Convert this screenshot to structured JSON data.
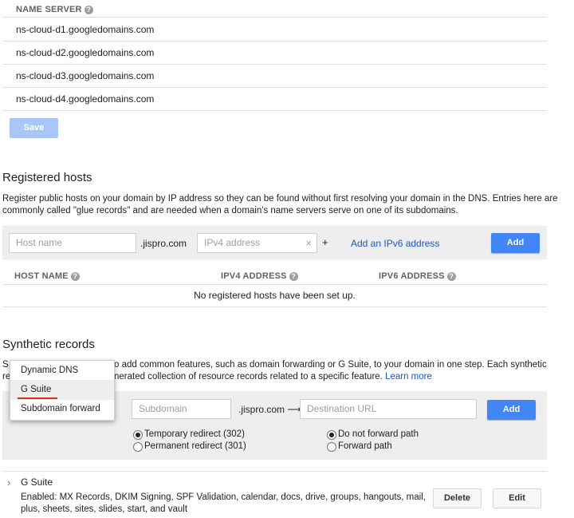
{
  "nameservers": {
    "header": "NAME SERVER",
    "items": [
      "ns-cloud-d1.googledomains.com",
      "ns-cloud-d2.googledomains.com",
      "ns-cloud-d3.googledomains.com",
      "ns-cloud-d4.googledomains.com"
    ],
    "save_label": "Save"
  },
  "registered_hosts": {
    "title": "Registered hosts",
    "description_line1": "Register public hosts on your domain by IP address so they can be found without first resolving your domain in the DNS. Entries here are",
    "description_line2": "commonly called \"glue records\" and are needed when a domain's name servers serve on one of its subdomains.",
    "host_placeholder": "Host name",
    "domain_suffix": ".jispro.com",
    "ipv4_placeholder": "IPv4 address",
    "clear_glyph": "×",
    "plus_glyph": "+",
    "add_ipv6_link": "Add an IPv6 address",
    "add_label": "Add",
    "columns": [
      "HOST NAME",
      "IPV4 ADDRESS",
      "IPV6 ADDRESS"
    ],
    "empty_message": "No registered hosts have been set up."
  },
  "synthetic_records": {
    "title": "Synthetic records",
    "description_line1_lead": "S",
    "description_line1": "o add common features, such as domain forwarding or G Suite, to your domain in one step. Each synthetic",
    "description_line2_lead": "re",
    "description_line2": "nerated collection of resource records related to a specific feature.",
    "learn_more": "Learn more",
    "dropdown_options": [
      "Dynamic DNS",
      "G Suite",
      "Subdomain forward"
    ],
    "dropdown_selected": "G Suite",
    "subdomain_placeholder": "Subdomain",
    "domain_arrow": ".jispro.com ⟶",
    "destination_placeholder": "Destination URL",
    "add_label": "Add",
    "redirect_options": [
      "Temporary redirect (302)",
      "Permanent redirect (301)"
    ],
    "path_options": [
      "Do not forward path",
      "Forward path"
    ],
    "records": [
      {
        "name": "G Suite",
        "details_line1": "Enabled: MX Records, DKIM Signing, SPF Validation, calendar, docs, drive, groups, hangouts, mail,",
        "details_line2": "plus, sheets, sites, slides, start, and vault",
        "delete_label": "Delete",
        "edit_label": "Edit"
      }
    ]
  },
  "colors": {
    "accent": "#4285f4",
    "link": "#1a57c9",
    "panel": "#eeeeee",
    "underline": "#d93025"
  }
}
